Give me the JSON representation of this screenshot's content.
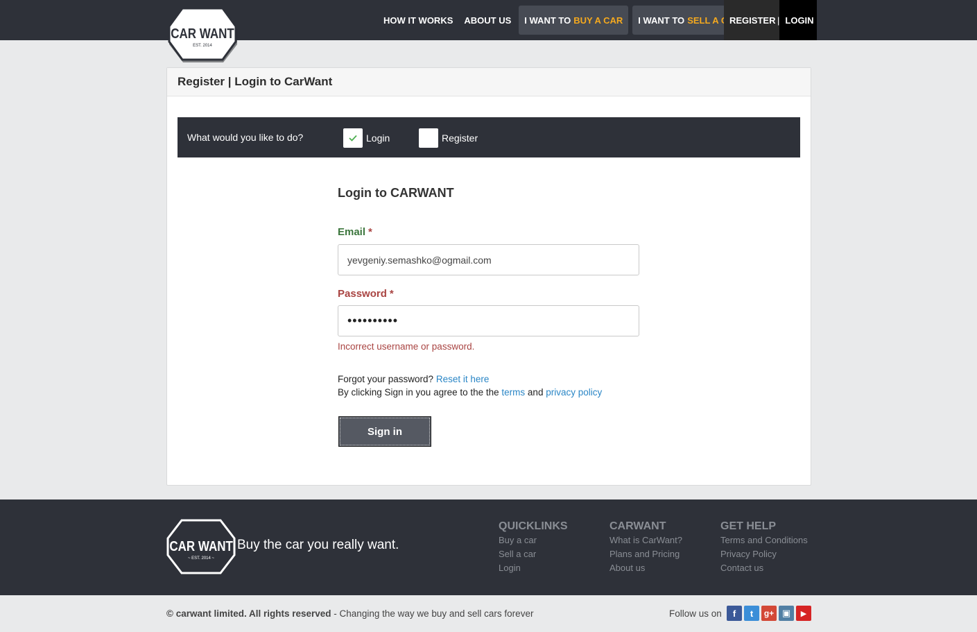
{
  "brand": {
    "logo_text": "CAR WANT",
    "logo_est": "EST. 2014",
    "footer_logo_est": "~ EST. 2014 ~"
  },
  "nav": {
    "how_it_works": "HOW IT WORKS",
    "about_us": "ABOUT US",
    "buy_prefix": "I WANT TO",
    "buy_highlight": "BUY A CAR",
    "sell_prefix": "I WANT TO",
    "sell_highlight": "SELL A CAR",
    "register": "REGISTER",
    "separator": "|",
    "login": "LOGIN"
  },
  "card": {
    "title": "Register | Login to CarWant"
  },
  "choice": {
    "question": "What would you like to do?",
    "options": [
      {
        "label": "Login",
        "checked": true
      },
      {
        "label": "Register",
        "checked": false
      }
    ]
  },
  "form": {
    "title": "Login to CARWANT",
    "email_label": "Email",
    "email_value": "yevgeniy.semashko@ogmail.com",
    "password_label": "Password",
    "password_value": "••••••••••",
    "required_mark": "*",
    "error": "Incorrect username or password.",
    "forgot_text": "Forgot your password?",
    "reset_link": "Reset it here",
    "agree_text": "By clicking Sign in you agree to the the",
    "terms_link": "terms",
    "and_text": "and",
    "privacy_link": "privacy policy",
    "signin_button": "Sign in"
  },
  "footer": {
    "tagline": "Buy the car you really want.",
    "columns": [
      {
        "heading": "QUICKLINKS",
        "links": [
          "Buy a car",
          "Sell a car",
          "Login"
        ]
      },
      {
        "heading": "CARWANT",
        "links": [
          "What is CarWant?",
          "Plans and Pricing",
          "About us"
        ]
      },
      {
        "heading": "GET HELP",
        "links": [
          "Terms and Conditions",
          "Privacy Policy",
          "Contact us"
        ]
      }
    ],
    "copyright_bold": "© carwant limited. All rights reserved",
    "copyright_rest": "- Changing the way we buy and sell cars forever",
    "follow_text": "Follow us on",
    "social": [
      {
        "icon": "facebook-icon",
        "glyph": "f",
        "color": "#3b5998"
      },
      {
        "icon": "twitter-icon",
        "glyph": "t",
        "color": "#3b8ed8"
      },
      {
        "icon": "google-plus-icon",
        "glyph": "g+",
        "color": "#d34836"
      },
      {
        "icon": "instagram-icon",
        "glyph": "▣",
        "color": "#517fa4"
      },
      {
        "icon": "youtube-icon",
        "glyph": "▶",
        "color": "#d62424"
      }
    ]
  },
  "colors": {
    "accent": "#f5a91e",
    "dark": "#2e3139",
    "link": "#2a86c6",
    "error": "#a94442",
    "success": "#3c763d"
  }
}
